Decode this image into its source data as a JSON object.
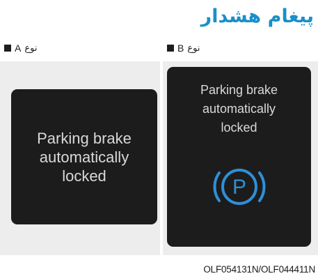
{
  "page": {
    "title": "پیغام هشدار",
    "caption": "OLF054131N/OLF044411N"
  },
  "panels": [
    {
      "type_letter": "A",
      "type_word": "نوع",
      "message_lines": [
        "Parking brake",
        "automatically",
        "locked"
      ]
    },
    {
      "type_letter": "B",
      "type_word": "نوع",
      "message_lines": [
        "Parking brake",
        "automatically",
        "locked"
      ],
      "icon": "parking-brake-icon",
      "icon_color": "#2f8fd6"
    }
  ]
}
